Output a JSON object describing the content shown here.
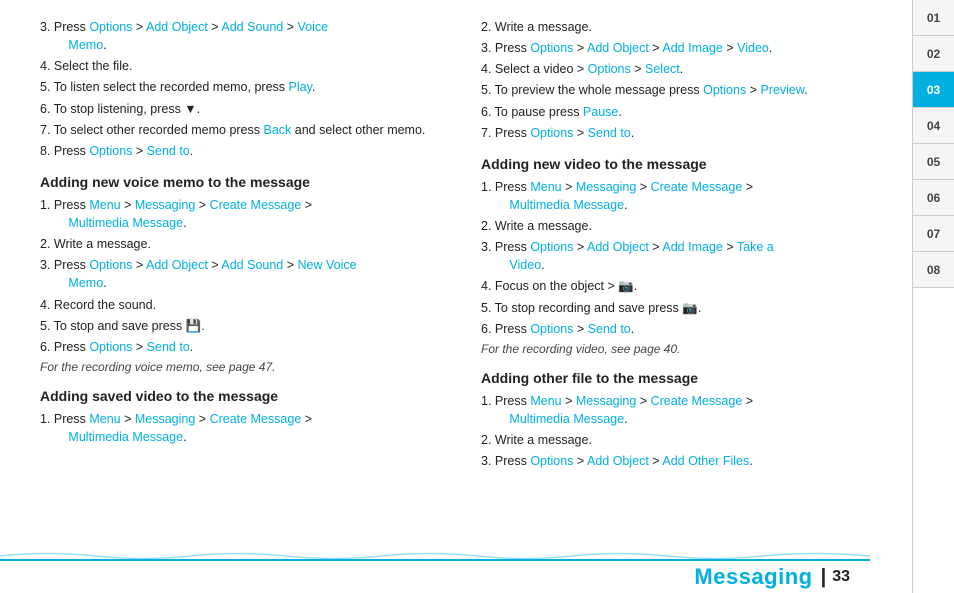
{
  "page": {
    "number": "33",
    "title": "Messaging"
  },
  "tabs": [
    {
      "id": "01",
      "label": "01",
      "active": false
    },
    {
      "id": "02",
      "label": "02",
      "active": false
    },
    {
      "id": "03",
      "label": "03",
      "active": true
    },
    {
      "id": "04",
      "label": "04",
      "active": false
    },
    {
      "id": "05",
      "label": "05",
      "active": false
    },
    {
      "id": "06",
      "label": "06",
      "active": false
    },
    {
      "id": "07",
      "label": "07",
      "active": false
    },
    {
      "id": "08",
      "label": "08",
      "active": false
    }
  ],
  "left_column": {
    "intro_list": [
      {
        "num": "3",
        "text_parts": [
          {
            "text": "Press ",
            "link": false
          },
          {
            "text": "Options",
            "link": true
          },
          {
            "text": " > ",
            "link": false
          },
          {
            "text": "Add Object",
            "link": true
          },
          {
            "text": " > ",
            "link": false
          },
          {
            "text": "Add Sound",
            "link": true
          },
          {
            "text": " > ",
            "link": false
          },
          {
            "text": "Voice\nMemo",
            "link": true
          }
        ]
      },
      {
        "num": "4",
        "text": "Select the file."
      },
      {
        "num": "5",
        "text_parts": [
          {
            "text": "To listen select the recorded memo, press ",
            "link": false
          },
          {
            "text": "Play",
            "link": true
          },
          {
            "text": ".",
            "link": false
          }
        ]
      },
      {
        "num": "6",
        "text": "To stop listening, press ▼."
      },
      {
        "num": "7",
        "text": "To select other recorded memo press Back and select other memo."
      },
      {
        "num": "8",
        "text_parts": [
          {
            "text": "Press ",
            "link": false
          },
          {
            "text": "Options",
            "link": true
          },
          {
            "text": " > ",
            "link": false
          },
          {
            "text": "Send to",
            "link": true
          },
          {
            "text": ".",
            "link": false
          }
        ]
      }
    ],
    "voice_memo_section": {
      "heading": "Adding new voice memo to the message",
      "items": [
        {
          "num": "1",
          "text_parts": [
            {
              "text": "Press ",
              "link": false
            },
            {
              "text": "Menu",
              "link": true
            },
            {
              "text": " > ",
              "link": false
            },
            {
              "text": "Messaging",
              "link": true
            },
            {
              "text": " > ",
              "link": false
            },
            {
              "text": "Create Message",
              "link": true
            },
            {
              "text": " > ",
              "link": false
            },
            {
              "text": "Multimedia Message",
              "link": true
            },
            {
              "text": ".",
              "link": false
            }
          ]
        },
        {
          "num": "2",
          "text": "Write a message."
        },
        {
          "num": "3",
          "text_parts": [
            {
              "text": "Press ",
              "link": false
            },
            {
              "text": "Options",
              "link": true
            },
            {
              "text": " > ",
              "link": false
            },
            {
              "text": "Add Object",
              "link": true
            },
            {
              "text": " > ",
              "link": false
            },
            {
              "text": "Add Sound",
              "link": true
            },
            {
              "text": " > ",
              "link": false
            },
            {
              "text": "New Voice\nMemo",
              "link": true
            },
            {
              "text": ".",
              "link": false
            }
          ]
        },
        {
          "num": "4",
          "text": "Record the sound."
        },
        {
          "num": "5",
          "text_parts": [
            {
              "text": "To stop and save press ",
              "link": false
            },
            {
              "text": "💾",
              "link": false
            },
            {
              "text": ".",
              "link": false
            }
          ]
        },
        {
          "num": "6",
          "text_parts": [
            {
              "text": "Press ",
              "link": false
            },
            {
              "text": "Options",
              "link": true
            },
            {
              "text": " > ",
              "link": false
            },
            {
              "text": "Send to",
              "link": true
            },
            {
              "text": ".",
              "link": false
            }
          ]
        }
      ],
      "footnote": "For the recording voice memo, see page 47."
    },
    "saved_video_section": {
      "heading": "Adding saved video to the message",
      "items": [
        {
          "num": "1",
          "text_parts": [
            {
              "text": "Press ",
              "link": false
            },
            {
              "text": "Menu",
              "link": true
            },
            {
              "text": " > ",
              "link": false
            },
            {
              "text": "Messaging",
              "link": true
            },
            {
              "text": " > ",
              "link": false
            },
            {
              "text": "Create Message",
              "link": true
            },
            {
              "text": " > ",
              "link": false
            },
            {
              "text": "Multimedia Message",
              "link": true
            },
            {
              "text": ".",
              "link": false
            }
          ]
        }
      ]
    }
  },
  "right_column": {
    "right_intro_list": [
      {
        "num": "2",
        "text": "Write a message."
      },
      {
        "num": "3",
        "text_parts": [
          {
            "text": "Press ",
            "link": false
          },
          {
            "text": "Options",
            "link": true
          },
          {
            "text": " > ",
            "link": false
          },
          {
            "text": "Add Object",
            "link": true
          },
          {
            "text": " > ",
            "link": false
          },
          {
            "text": "Add Image",
            "link": true
          },
          {
            "text": " > ",
            "link": false
          },
          {
            "text": "Video",
            "link": true
          },
          {
            "text": ".",
            "link": false
          }
        ]
      },
      {
        "num": "4",
        "text_parts": [
          {
            "text": "Select a video > ",
            "link": false
          },
          {
            "text": "Options",
            "link": true
          },
          {
            "text": " > ",
            "link": false
          },
          {
            "text": "Select",
            "link": true
          },
          {
            "text": ".",
            "link": false
          }
        ]
      },
      {
        "num": "5",
        "text_parts": [
          {
            "text": "To preview the whole message press ",
            "link": false
          },
          {
            "text": "Options",
            "link": true
          },
          {
            "text": " > ",
            "link": false
          },
          {
            "text": "Preview",
            "link": true
          },
          {
            "text": ".",
            "link": false
          }
        ]
      },
      {
        "num": "6",
        "text_parts": [
          {
            "text": "To pause press ",
            "link": false
          },
          {
            "text": "Pause",
            "link": true
          },
          {
            "text": ".",
            "link": false
          }
        ]
      },
      {
        "num": "7",
        "text_parts": [
          {
            "text": "Press ",
            "link": false
          },
          {
            "text": "Options",
            "link": true
          },
          {
            "text": " > ",
            "link": false
          },
          {
            "text": "Send to",
            "link": true
          },
          {
            "text": ".",
            "link": false
          }
        ]
      }
    ],
    "new_video_section": {
      "heading": "Adding new video to the message",
      "items": [
        {
          "num": "1",
          "text_parts": [
            {
              "text": "Press ",
              "link": false
            },
            {
              "text": "Menu",
              "link": true
            },
            {
              "text": " > ",
              "link": false
            },
            {
              "text": "Messaging",
              "link": true
            },
            {
              "text": " > ",
              "link": false
            },
            {
              "text": "Create Message",
              "link": true
            },
            {
              "text": " > ",
              "link": false
            },
            {
              "text": "Multimedia Message",
              "link": true
            },
            {
              "text": ".",
              "link": false
            }
          ]
        },
        {
          "num": "2",
          "text": "Write a message."
        },
        {
          "num": "3",
          "text_parts": [
            {
              "text": "Press ",
              "link": false
            },
            {
              "text": "Options",
              "link": true
            },
            {
              "text": " > ",
              "link": false
            },
            {
              "text": "Add Object",
              "link": true
            },
            {
              "text": " > ",
              "link": false
            },
            {
              "text": "Add Image",
              "link": true
            },
            {
              "text": " > ",
              "link": false
            },
            {
              "text": "Take a\nVideo",
              "link": true
            },
            {
              "text": ".",
              "link": false
            }
          ]
        },
        {
          "num": "4",
          "text_parts": [
            {
              "text": "Focus on the object > ",
              "link": false
            },
            {
              "text": "📷",
              "link": false
            },
            {
              "text": ".",
              "link": false
            }
          ]
        },
        {
          "num": "5",
          "text_parts": [
            {
              "text": "To stop recording and save press ",
              "link": false
            },
            {
              "text": "📷",
              "link": false
            },
            {
              "text": ".",
              "link": false
            }
          ]
        },
        {
          "num": "6",
          "text_parts": [
            {
              "text": "Press ",
              "link": false
            },
            {
              "text": "Options",
              "link": true
            },
            {
              "text": " > ",
              "link": false
            },
            {
              "text": "Send to",
              "link": true
            },
            {
              "text": ".",
              "link": false
            }
          ]
        }
      ],
      "footnote": "For the recording video, see page 40."
    },
    "other_file_section": {
      "heading": "Adding other file to the message",
      "items": [
        {
          "num": "1",
          "text_parts": [
            {
              "text": "Press ",
              "link": false
            },
            {
              "text": "Menu",
              "link": true
            },
            {
              "text": " > ",
              "link": false
            },
            {
              "text": "Messaging",
              "link": true
            },
            {
              "text": " > ",
              "link": false
            },
            {
              "text": "Create Message",
              "link": true
            },
            {
              "text": " > ",
              "link": false
            },
            {
              "text": "Multimedia Message",
              "link": true
            },
            {
              "text": ".",
              "link": false
            }
          ]
        },
        {
          "num": "2",
          "text": "Write a message."
        },
        {
          "num": "3",
          "text_parts": [
            {
              "text": "Press ",
              "link": false
            },
            {
              "text": "Options",
              "link": true
            },
            {
              "text": " > ",
              "link": false
            },
            {
              "text": "Add Object",
              "link": true
            },
            {
              "text": " > ",
              "link": false
            },
            {
              "text": "Add Other Files",
              "link": true
            },
            {
              "text": ".",
              "link": false
            }
          ]
        }
      ]
    }
  }
}
